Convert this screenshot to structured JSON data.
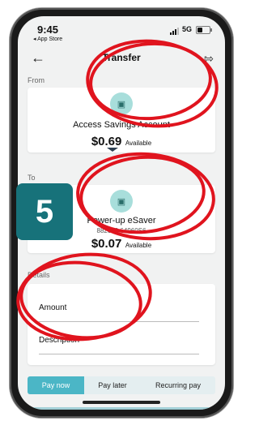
{
  "status_bar": {
    "time": "9:45",
    "back_app": "◂ App Store",
    "network": "5G"
  },
  "header": {
    "title": "Transfer"
  },
  "from": {
    "section_label": "From",
    "account_name": "Access Savings Account",
    "balance": "$0.69",
    "available_label": "Available"
  },
  "to": {
    "section_label": "To",
    "account_name": "Power-up eSaver",
    "account_number": "882000 64960S6",
    "balance": "$0.07",
    "available_label": "Available"
  },
  "details": {
    "section_label": "Details",
    "amount_label": "Amount",
    "description_label": "Description"
  },
  "schedule_tabs": [
    "Pay now",
    "Pay later",
    "Recurring pay"
  ],
  "step_badge": "5",
  "icons": {
    "back": "arrow-left-icon",
    "logout": "logout-icon",
    "account": "money-stack-icon"
  },
  "colors": {
    "accent": "#4bb6c6",
    "badge": "#17727a",
    "annotation": "#e0141e",
    "icon_bg": "#a8dedb"
  }
}
